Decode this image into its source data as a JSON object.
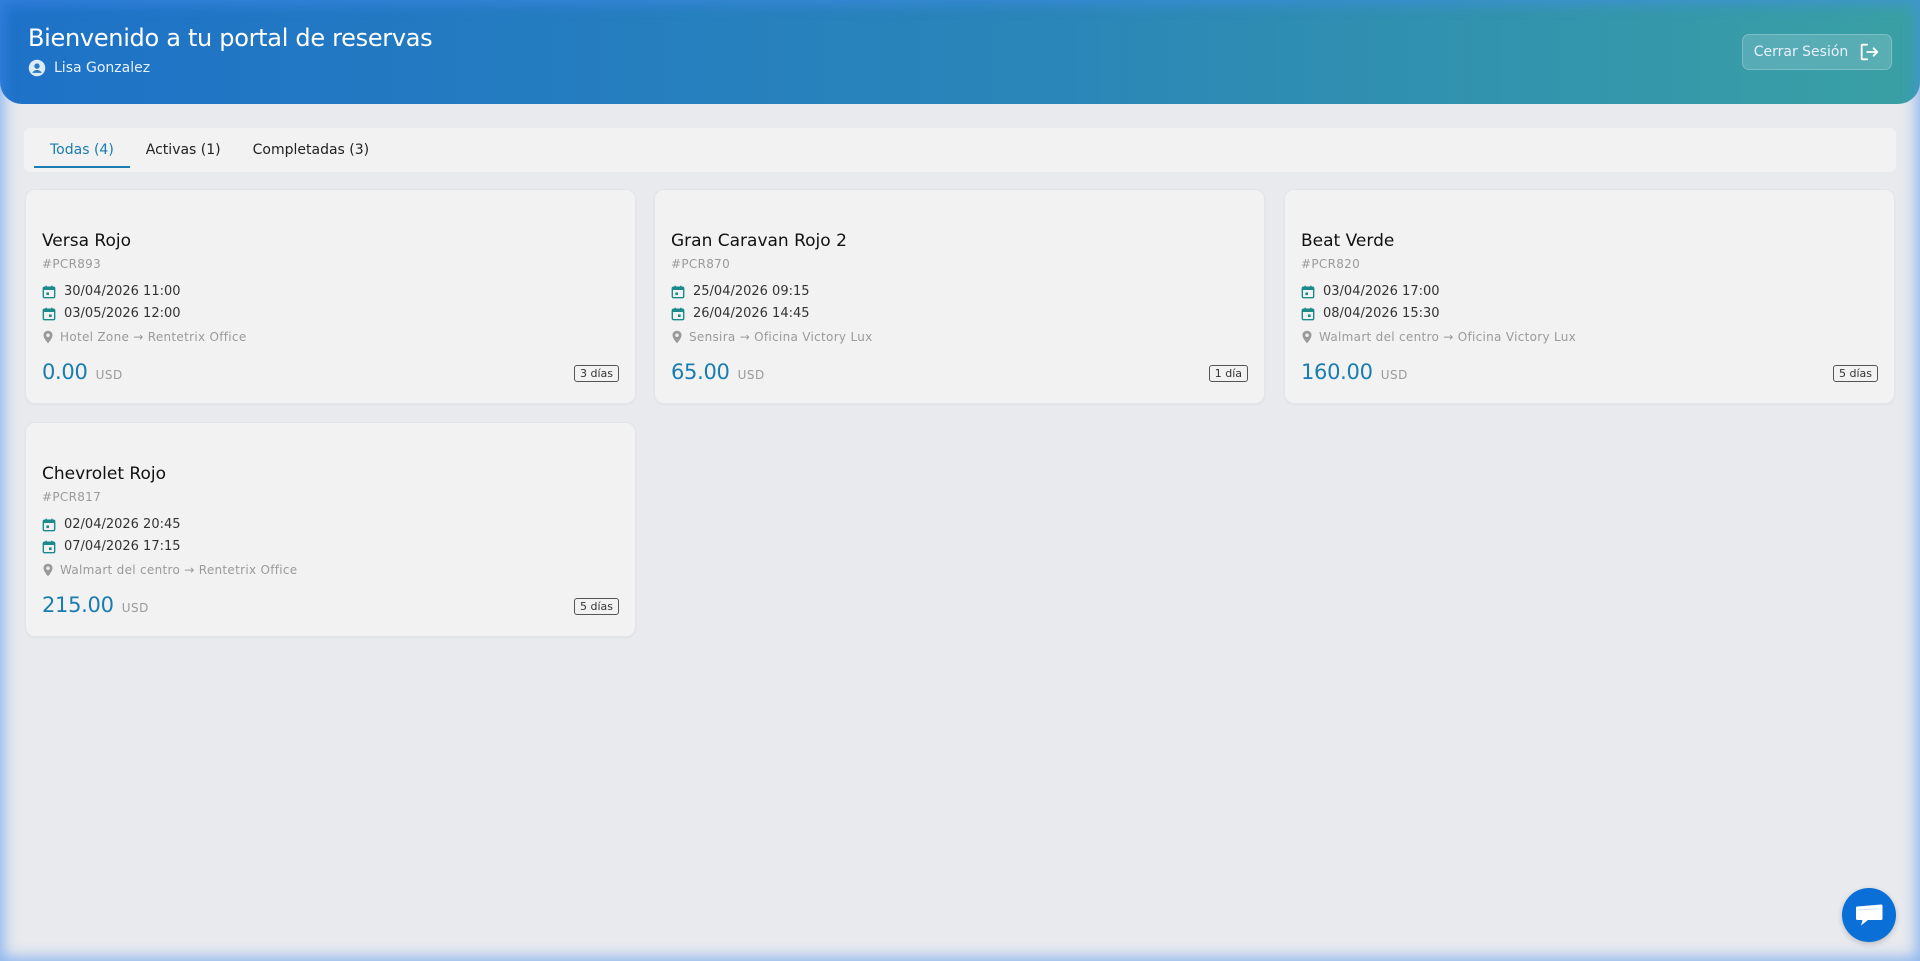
{
  "header": {
    "title": "Bienvenido a tu portal de reservas",
    "user_name": "Lisa Gonzalez",
    "user_icon": "account-circle-icon",
    "logout_label": "Cerrar Sesión",
    "logout_icon": "logout-icon"
  },
  "tabs": [
    {
      "label": "Todas (4)",
      "active": true
    },
    {
      "label": "Activas (1)",
      "active": false
    },
    {
      "label": "Completadas (3)",
      "active": false
    }
  ],
  "reservations": [
    {
      "vehicle": "Versa Rojo",
      "code": "#PCR893",
      "pickup": "30/04/2026 11:00",
      "dropoff": "03/05/2026 12:00",
      "route": "Hotel Zone → Rentetrix Office",
      "amount": "0.00",
      "currency": "USD",
      "days": "3 días"
    },
    {
      "vehicle": "Gran Caravan Rojo 2",
      "code": "#PCR870",
      "pickup": "25/04/2026 09:15",
      "dropoff": "26/04/2026 14:45",
      "route": "Sensira → Oficina Victory Lux",
      "amount": "65.00",
      "currency": "USD",
      "days": "1 día"
    },
    {
      "vehicle": "Beat Verde",
      "code": "#PCR820",
      "pickup": "03/04/2026 17:00",
      "dropoff": "08/04/2026 15:30",
      "route": "Walmart del centro → Oficina Victory Lux",
      "amount": "160.00",
      "currency": "USD",
      "days": "5 días"
    },
    {
      "vehicle": "Chevrolet Rojo",
      "code": "#PCR817",
      "pickup": "02/04/2026 20:45",
      "dropoff": "07/04/2026 17:15",
      "route": "Walmart del centro → Rentetrix Office",
      "amount": "215.00",
      "currency": "USD",
      "days": "5 días"
    }
  ],
  "chat": {
    "icon": "chat-bubble-icon"
  },
  "colors": {
    "accent": "#1a7cb0",
    "header_start": "#1e72c8",
    "header_end": "#3aa0a4",
    "calendar_icon": "#1a8a8a",
    "chat_button": "#0a6fd6"
  }
}
